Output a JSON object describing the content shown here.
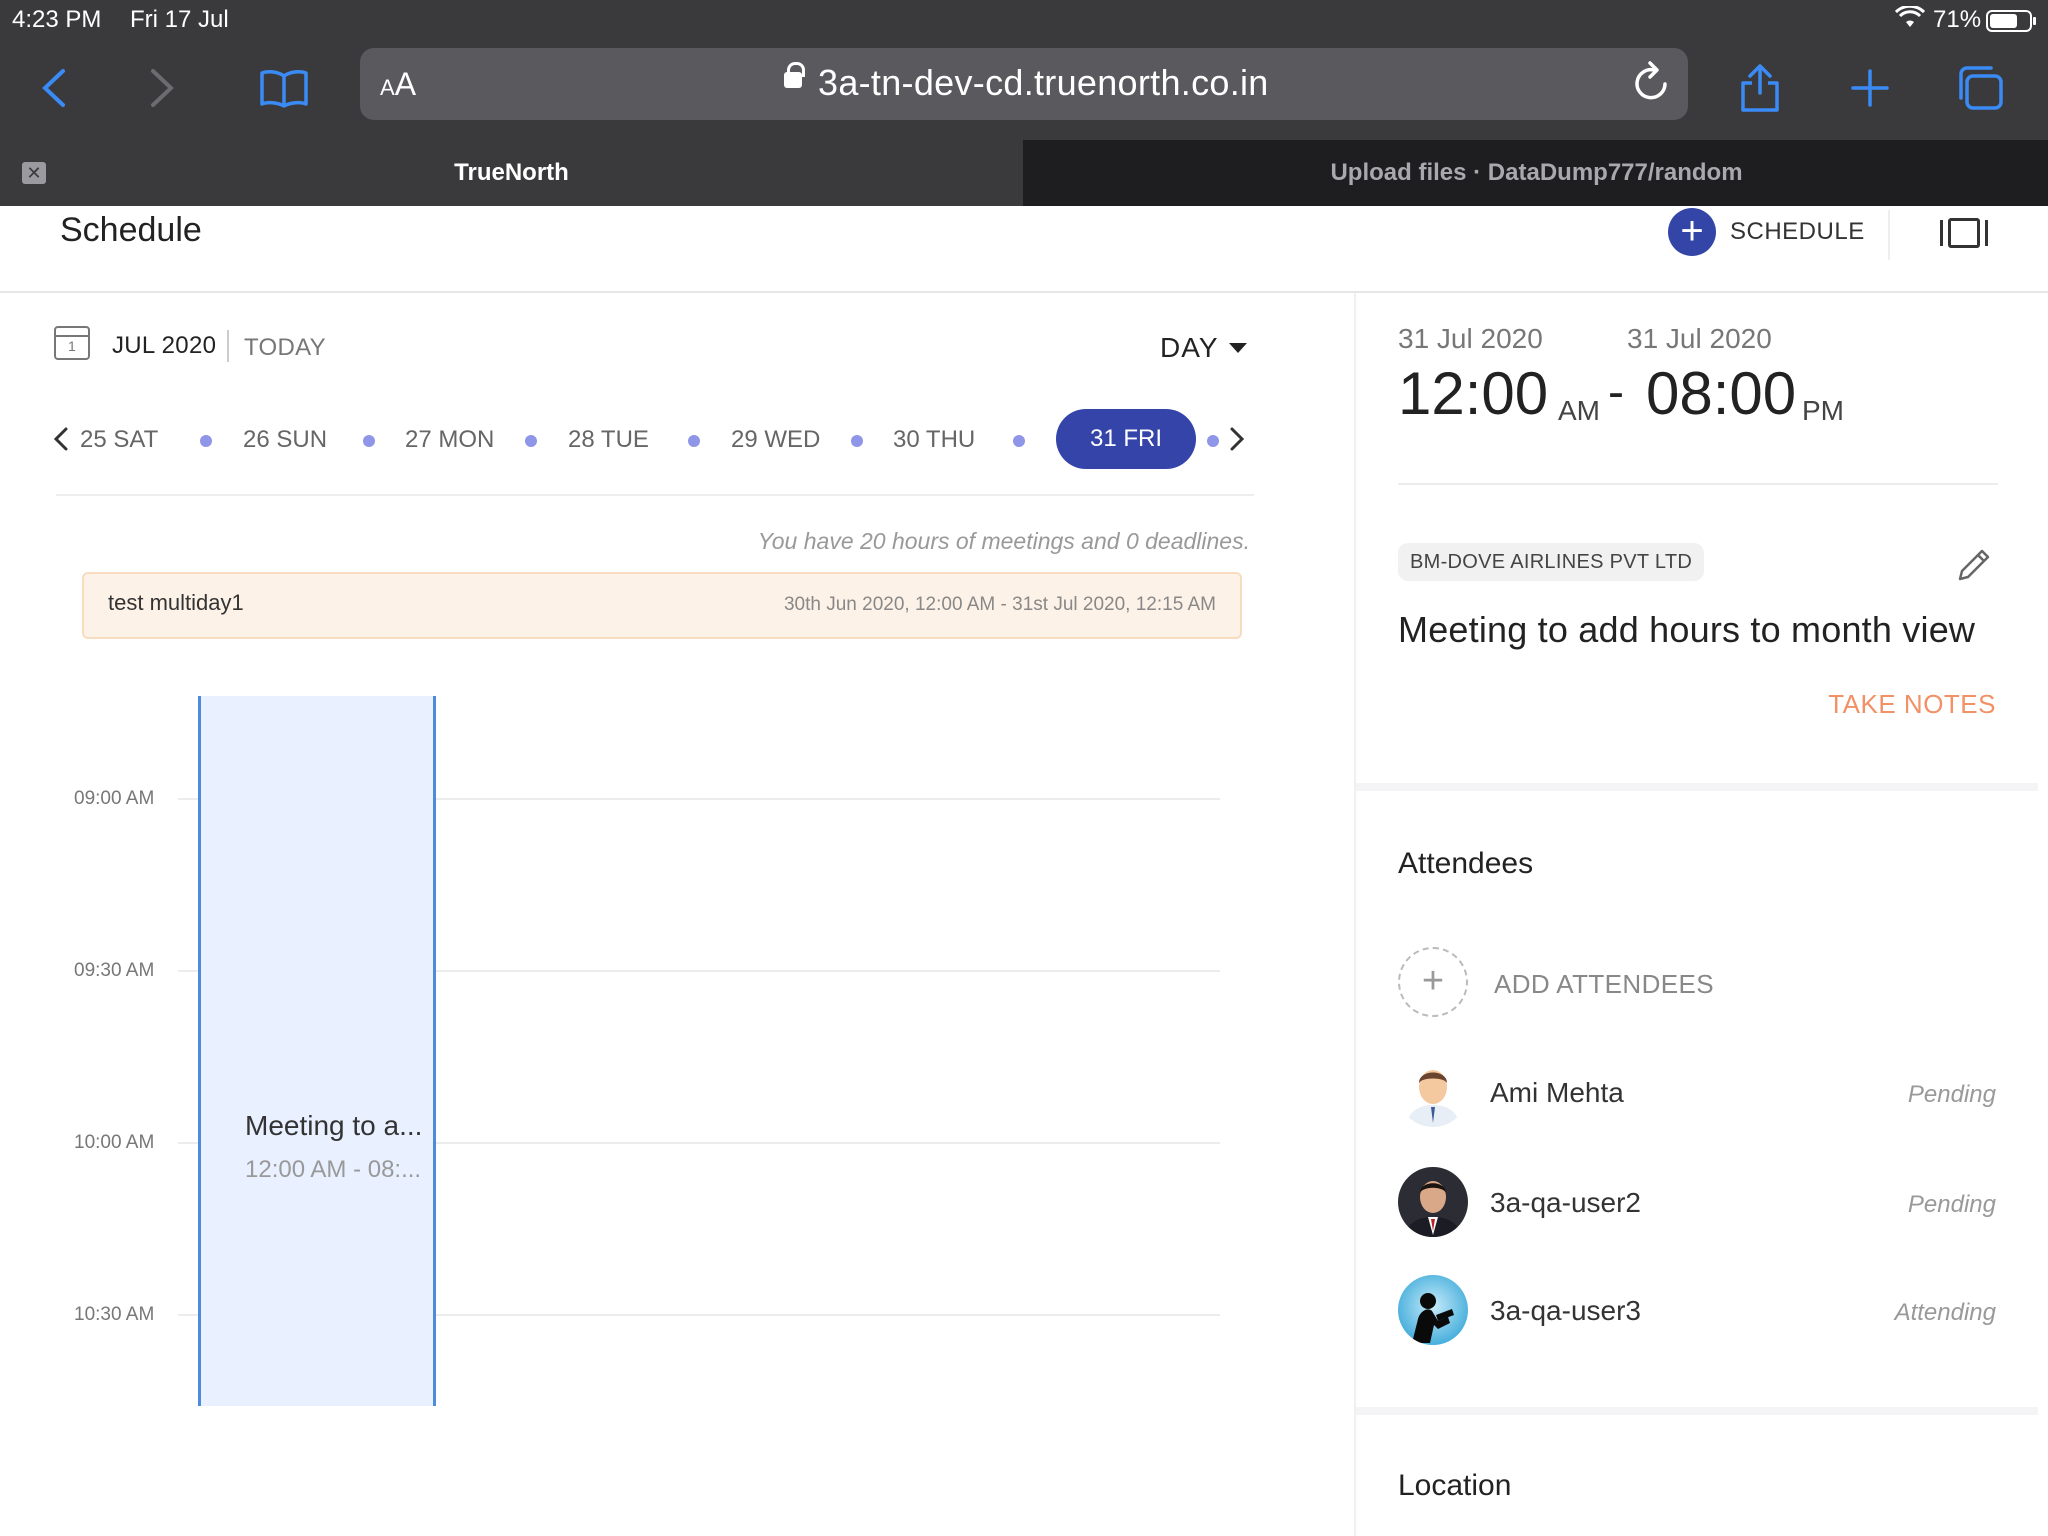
{
  "status_bar": {
    "time": "4:23 PM",
    "date": "Fri 17 Jul",
    "battery": "71%",
    "battery_level": 0.71
  },
  "browser": {
    "reader_label_small": "A",
    "reader_label_big": "A",
    "url": "3a-tn-dev-cd.truenorth.co.in",
    "tabs": [
      {
        "title": "TrueNorth",
        "active": true
      },
      {
        "title": "Upload files · DataDump777/random",
        "active": false
      }
    ],
    "accent": "#3a8bf5"
  },
  "header": {
    "title": "Schedule",
    "schedule_button": "SCHEDULE"
  },
  "calendar": {
    "month": "JUL 2020",
    "today": "TODAY",
    "view": "DAY",
    "days": [
      "25 SAT",
      "26 SUN",
      "27 MON",
      "28 TUE",
      "29 WED",
      "30 THU",
      "31 FRI"
    ],
    "selected_day": "31 FRI",
    "summary": "You have 20 hours of meetings and 0 deadlines.",
    "all_day_event": {
      "title": "test multiday1",
      "dates": "30th Jun 2020, 12:00 AM - 31st Jul 2020, 12:15 AM"
    },
    "time_slots": [
      "09:00 AM",
      "09:30 AM",
      "10:00 AM",
      "10:30 AM"
    ],
    "event": {
      "title": "Meeting to a...",
      "time": "12:00 AM - 08:..."
    }
  },
  "detail": {
    "start_date": "31 Jul 2020",
    "end_date": "31 Jul 2020",
    "start_time": "12:00",
    "start_ampm": "AM",
    "end_time": "08:00",
    "end_ampm": "PM",
    "dash": "-",
    "organization": "BM-DOVE AIRLINES PVT LTD",
    "title": "Meeting to add hours to month view",
    "take_notes": "TAKE NOTES",
    "attendees_title": "Attendees",
    "add_attendees": "ADD ATTENDEES",
    "attendees": [
      {
        "name": "Ami Mehta",
        "status": "Pending"
      },
      {
        "name": "3a-qa-user2",
        "status": "Pending"
      },
      {
        "name": "3a-qa-user3",
        "status": "Attending"
      }
    ],
    "location_title": "Location"
  }
}
